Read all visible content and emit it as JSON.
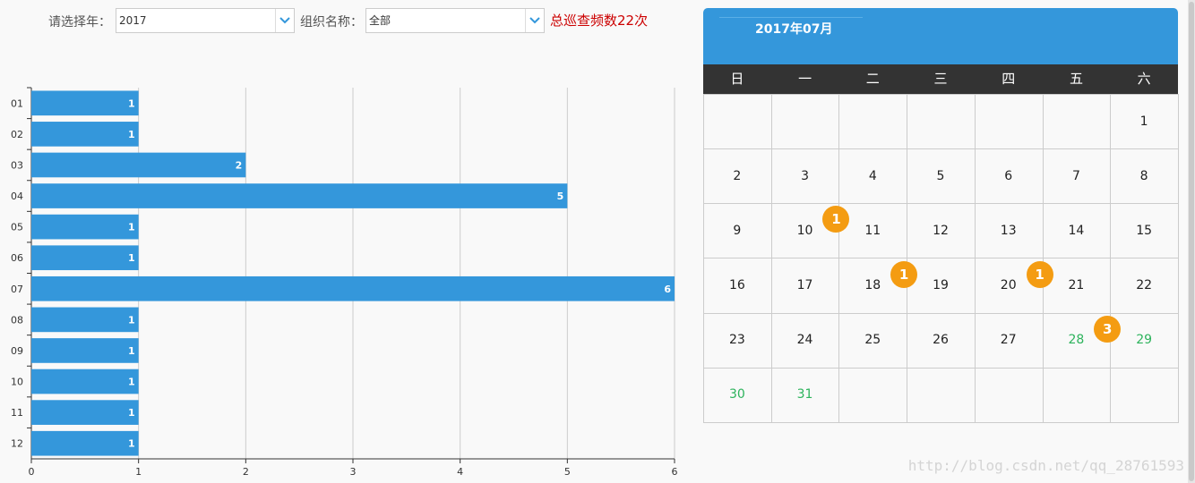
{
  "filters": {
    "year_label": "请选择年：",
    "year_value": "2017",
    "org_label": "组织名称：",
    "org_value": "全部",
    "total_text": "总巡查频数22次"
  },
  "chart_data": {
    "type": "bar",
    "orientation": "horizontal",
    "categories": [
      "01",
      "02",
      "03",
      "04",
      "05",
      "06",
      "07",
      "08",
      "09",
      "10",
      "11",
      "12"
    ],
    "values": [
      1,
      1,
      2,
      5,
      1,
      1,
      6,
      1,
      1,
      1,
      1,
      1
    ],
    "xlim": [
      0,
      6
    ],
    "xticks": [
      0,
      1,
      2,
      3,
      4,
      5,
      6
    ],
    "grid": true,
    "bar_color": "#3497db"
  },
  "calendar": {
    "title": "2017年07月",
    "weekdays": [
      "日",
      "一",
      "二",
      "三",
      "四",
      "五",
      "六"
    ],
    "start_weekday": 6,
    "days_in_month": 31,
    "today": 28,
    "badges": [
      {
        "day": 10,
        "count": "1"
      },
      {
        "day": 18,
        "count": "1"
      },
      {
        "day": 20,
        "count": "1"
      },
      {
        "day": 28,
        "count": "3"
      }
    ],
    "header_color": "#3497db",
    "future_color": "#2db35c",
    "badge_color": "#f49c12"
  },
  "watermark": "http://blog.csdn.net/qq_28761593"
}
